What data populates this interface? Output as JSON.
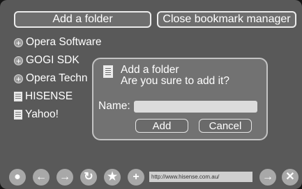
{
  "header": {
    "add_folder_label": "Add a folder",
    "close_label": "Close bookmark manager"
  },
  "bookmarks": [
    {
      "label": "Opera Software",
      "icon": "folder-plus-icon"
    },
    {
      "label": "GOGI SDK",
      "icon": "folder-plus-icon"
    },
    {
      "label": "Opera Techn",
      "icon": "folder-plus-icon"
    },
    {
      "label": "HISENSE",
      "icon": "page-icon"
    },
    {
      "label": "Yahoo!",
      "icon": "page-icon"
    }
  ],
  "dialog": {
    "title": "Add a folder",
    "message": "Are you sure to add it?",
    "name_label": "Name:",
    "name_value": "",
    "ok_label": "Add",
    "cancel_label": "Cancel"
  },
  "toolbar": {
    "url": "http://www.hisense.com.au/",
    "buttons": [
      "globe-icon",
      "back-icon",
      "forward-icon",
      "reload-icon",
      "bookmark-star-icon",
      "bookmark-manager-icon",
      "go-icon",
      "close-icon"
    ]
  }
}
